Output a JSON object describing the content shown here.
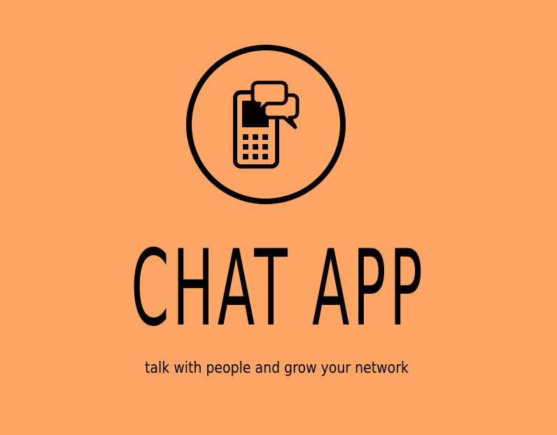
{
  "logo": {
    "icon": "phone-chat-icon",
    "stroke_color": "#000000"
  },
  "title": "CHAT APP",
  "tagline": "talk with people and grow your network",
  "colors": {
    "background": "#FFA566",
    "foreground": "#000000"
  }
}
